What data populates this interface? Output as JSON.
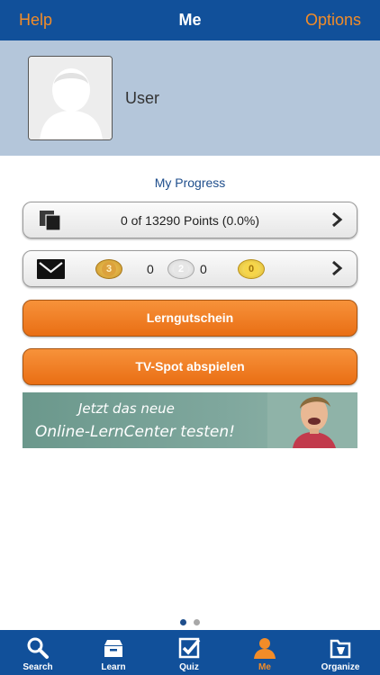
{
  "colors": {
    "navbar": "#11509a",
    "accent": "#f28c28",
    "profile_bg": "#b4c6da",
    "button_orange": "#ee7d23",
    "dot_active": "#1f4e8c",
    "dot_inactive": "#a8a8a8"
  },
  "navbar": {
    "left": "Help",
    "title": "Me",
    "right": "Options"
  },
  "profile": {
    "name": "User"
  },
  "progress": {
    "title": "My Progress",
    "points": "0 of 13290 Points (0.0%)",
    "medals": [
      {
        "badge": "3",
        "count": "0",
        "icon": "bronze-medal"
      },
      {
        "badge": "2",
        "count": "0",
        "icon": "silver-medal"
      },
      {
        "badge": "0",
        "icon": "gold-medal"
      }
    ]
  },
  "buttons": {
    "voucher": "Lerngutschein",
    "tv_spot": "TV-Spot abspielen"
  },
  "banner": {
    "line1": "Jetzt das neue",
    "line2": "Online-LernCenter testen!"
  },
  "pager": {
    "pages": 2,
    "current": 1
  },
  "tabs": [
    {
      "label": "Search",
      "icon": "search-icon"
    },
    {
      "label": "Learn",
      "icon": "learn-icon"
    },
    {
      "label": "Quiz",
      "icon": "quiz-icon"
    },
    {
      "label": "Me",
      "icon": "person-icon",
      "active": true
    },
    {
      "label": "Organize",
      "icon": "organize-icon"
    }
  ]
}
